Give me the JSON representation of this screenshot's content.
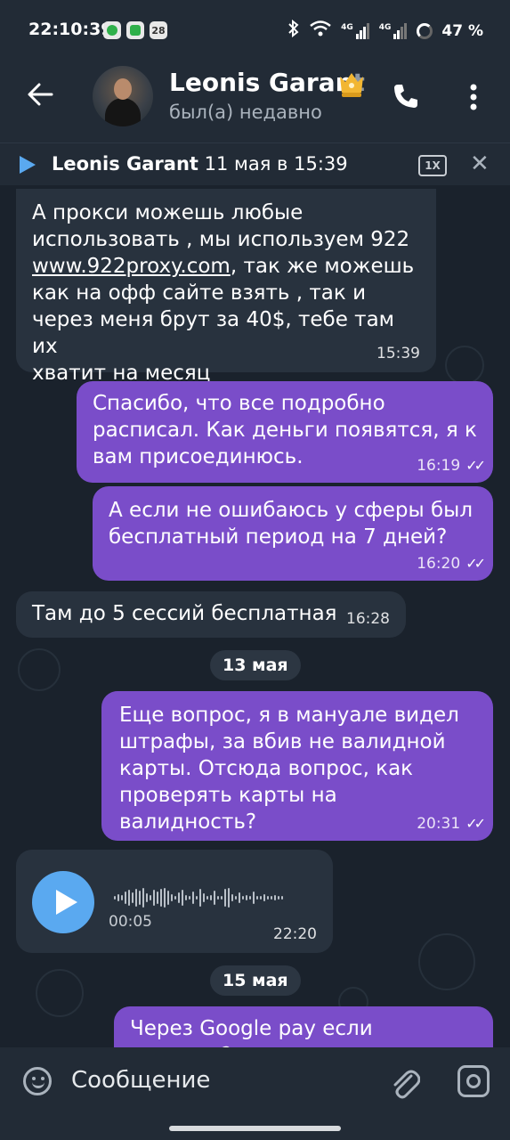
{
  "status_bar": {
    "time": "22:10:39",
    "battery": "47 %",
    "net1": "4G",
    "net2": "4G",
    "calendar_day": "28"
  },
  "header": {
    "name_main": "Leonis Garan",
    "name_fade": "t",
    "status": "был(а) недавно"
  },
  "player": {
    "sender": "Leonis Garant",
    "date": "11 мая в 15:39",
    "speed": "1X"
  },
  "messages": [
    {
      "dir": "in",
      "text_pre": "А прокси можешь любые\nиспользовать , мы используем 922\n",
      "link": "www.922proxy.com",
      "text_post": ", так же можешь\nкак на офф сайте взять , так и\nчерез меня брут за 40$, тебе там их\nхватит на месяц",
      "time": "15:39"
    },
    {
      "dir": "out",
      "text": "Спасибо, что все подробно\nрасписал. Как деньги появятся, я к\nвам присоединюсь.",
      "time": "16:19"
    },
    {
      "dir": "out",
      "text": "А если не ошибаюсь у сферы был\nбесплатный период на 7 дней?",
      "time": "16:20"
    },
    {
      "dir": "in",
      "text": "Там до 5 сессий бесплатная",
      "time": "16:28"
    },
    {
      "dir": "out",
      "text": "Еще вопрос, я в мануале видел\nштрафы, за вбив не валидной\nкарты. Отсюда вопрос, как\nпроверять карты на валидность?",
      "time": "20:31"
    },
    {
      "dir": "in",
      "type": "voice",
      "duration": "00:05",
      "time": "22:20"
    },
    {
      "dir": "out",
      "text": "Через Google pay если вяжется?"
    }
  ],
  "dates": [
    "13 мая",
    "15 мая"
  ],
  "input": {
    "placeholder": "Сообщение"
  },
  "colors": {
    "outgoing_bubble": "#7a4dc9",
    "incoming_bubble": "#28323e",
    "accent": "#5aa9f0",
    "background": "#1a222c"
  }
}
